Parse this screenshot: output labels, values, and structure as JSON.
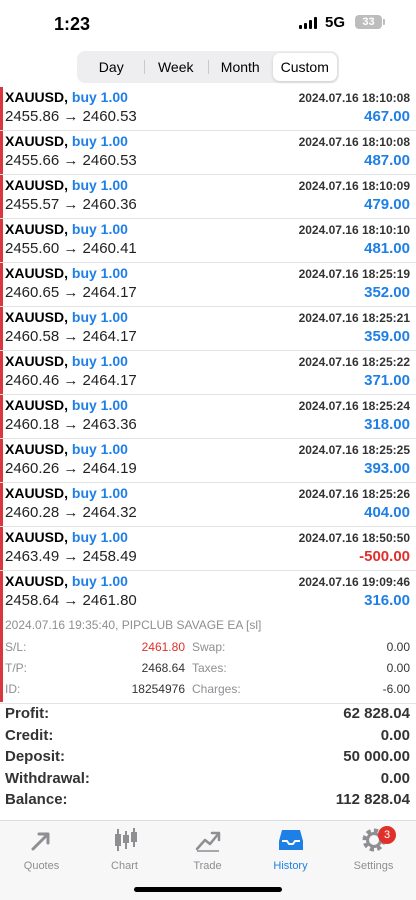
{
  "status": {
    "time": "1:23",
    "network": "5G",
    "battery": "33"
  },
  "segments": [
    {
      "label": "Day",
      "active": false
    },
    {
      "label": "Week",
      "active": false
    },
    {
      "label": "Month",
      "active": false
    },
    {
      "label": "Custom",
      "active": true
    }
  ],
  "trades": [
    {
      "symbol": "XAUUSD,",
      "side": "buy 1.00",
      "datetime": "2024.07.16 18:10:08",
      "prices": "2455.86 → 2460.53",
      "profit": "467.00"
    },
    {
      "symbol": "XAUUSD,",
      "side": "buy 1.00",
      "datetime": "2024.07.16 18:10:08",
      "prices": "2455.66 → 2460.53",
      "profit": "487.00"
    },
    {
      "symbol": "XAUUSD,",
      "side": "buy 1.00",
      "datetime": "2024.07.16 18:10:09",
      "prices": "2455.57 → 2460.36",
      "profit": "479.00"
    },
    {
      "symbol": "XAUUSD,",
      "side": "buy 1.00",
      "datetime": "2024.07.16 18:10:10",
      "prices": "2455.60 → 2460.41",
      "profit": "481.00"
    },
    {
      "symbol": "XAUUSD,",
      "side": "buy 1.00",
      "datetime": "2024.07.16 18:25:19",
      "prices": "2460.65 → 2464.17",
      "profit": "352.00"
    },
    {
      "symbol": "XAUUSD,",
      "side": "buy 1.00",
      "datetime": "2024.07.16 18:25:21",
      "prices": "2460.58 → 2464.17",
      "profit": "359.00"
    },
    {
      "symbol": "XAUUSD,",
      "side": "buy 1.00",
      "datetime": "2024.07.16 18:25:22",
      "prices": "2460.46 → 2464.17",
      "profit": "371.00"
    },
    {
      "symbol": "XAUUSD,",
      "side": "buy 1.00",
      "datetime": "2024.07.16 18:25:24",
      "prices": "2460.18 → 2463.36",
      "profit": "318.00"
    },
    {
      "symbol": "XAUUSD,",
      "side": "buy 1.00",
      "datetime": "2024.07.16 18:25:25",
      "prices": "2460.26 → 2464.19",
      "profit": "393.00"
    },
    {
      "symbol": "XAUUSD,",
      "side": "buy 1.00",
      "datetime": "2024.07.16 18:25:26",
      "prices": "2460.28 → 2464.32",
      "profit": "404.00"
    },
    {
      "symbol": "XAUUSD,",
      "side": "buy 1.00",
      "datetime": "2024.07.16 18:50:50",
      "prices": "2463.49 → 2458.49",
      "profit": "-500.00",
      "negative": true
    },
    {
      "symbol": "XAUUSD,",
      "side": "buy 1.00",
      "datetime": "2024.07.16 19:09:46",
      "prices": "2458.64 → 2461.80",
      "profit": "316.00"
    }
  ],
  "details": {
    "header": "2024.07.16 19:35:40, PIPCLUB SAVAGE EA [sl]",
    "sl_label": "S/L:",
    "sl_value": "2461.80",
    "tp_label": "T/P:",
    "tp_value": "2468.64",
    "id_label": "ID:",
    "id_value": "18254976",
    "swap_label": "Swap:",
    "swap_value": "0.00",
    "taxes_label": "Taxes:",
    "taxes_value": "0.00",
    "charges_label": "Charges:",
    "charges_value": "-6.00"
  },
  "summary": [
    {
      "label": "Profit:",
      "value": "62 828.04"
    },
    {
      "label": "Credit:",
      "value": "0.00"
    },
    {
      "label": "Deposit:",
      "value": "50 000.00"
    },
    {
      "label": "Withdrawal:",
      "value": "0.00"
    },
    {
      "label": "Balance:",
      "value": "112 828.04"
    }
  ],
  "tabs": [
    {
      "label": "Quotes",
      "icon": "quotes-icon"
    },
    {
      "label": "Chart",
      "icon": "chart-icon"
    },
    {
      "label": "Trade",
      "icon": "trade-icon"
    },
    {
      "label": "History",
      "icon": "history-icon",
      "active": true
    },
    {
      "label": "Settings",
      "icon": "gear-icon",
      "badge": "3"
    }
  ],
  "colors": {
    "accent": "#1e7fe6",
    "loss": "#e0302b",
    "sidebar_marker": "#d9363e"
  }
}
